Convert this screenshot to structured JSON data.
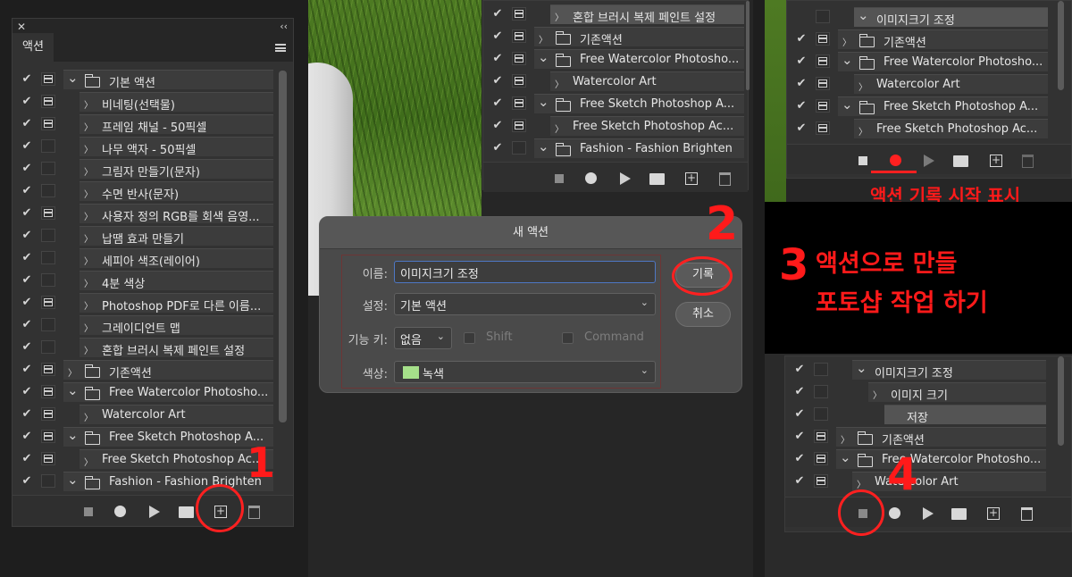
{
  "left_panel": {
    "tab_label": "액션",
    "rows": [
      {
        "checked": true,
        "toggle": true,
        "level": 0,
        "caret": "down",
        "folder": true,
        "label": "기본 액션"
      },
      {
        "checked": true,
        "toggle": true,
        "level": 1,
        "caret": "right",
        "folder": false,
        "label": "비네팅(선택물)"
      },
      {
        "checked": true,
        "toggle": true,
        "level": 1,
        "caret": "right",
        "folder": false,
        "label": "프레임 채널 - 50픽셀"
      },
      {
        "checked": true,
        "toggle": false,
        "level": 1,
        "caret": "right",
        "folder": false,
        "label": "나무 액자 - 50픽셀"
      },
      {
        "checked": true,
        "toggle": false,
        "level": 1,
        "caret": "right",
        "folder": false,
        "label": "그림자 만들기(문자)"
      },
      {
        "checked": true,
        "toggle": false,
        "level": 1,
        "caret": "right",
        "folder": false,
        "label": "수면 반사(문자)"
      },
      {
        "checked": true,
        "toggle": true,
        "level": 1,
        "caret": "right",
        "folder": false,
        "label": "사용자 정의 RGB를 회색 음영..."
      },
      {
        "checked": true,
        "toggle": false,
        "level": 1,
        "caret": "right",
        "folder": false,
        "label": "납땜 효과 만들기"
      },
      {
        "checked": true,
        "toggle": false,
        "level": 1,
        "caret": "right",
        "folder": false,
        "label": "세피아 색조(레이어)"
      },
      {
        "checked": true,
        "toggle": false,
        "level": 1,
        "caret": "right",
        "folder": false,
        "label": "4분 색상"
      },
      {
        "checked": true,
        "toggle": true,
        "level": 1,
        "caret": "right",
        "folder": false,
        "label": "Photoshop PDF로 다른 이름..."
      },
      {
        "checked": true,
        "toggle": false,
        "level": 1,
        "caret": "right",
        "folder": false,
        "label": "그레이디언트 맵"
      },
      {
        "checked": true,
        "toggle": false,
        "level": 1,
        "caret": "right",
        "folder": false,
        "label": "혼합 브러시 복제 페인트 설정"
      },
      {
        "checked": true,
        "toggle": true,
        "level": 0,
        "caret": "right",
        "folder": true,
        "label": "기존액션"
      },
      {
        "checked": true,
        "toggle": true,
        "level": 0,
        "caret": "down",
        "folder": true,
        "label": "Free Watercolor Photosho..."
      },
      {
        "checked": true,
        "toggle": true,
        "level": 1,
        "caret": "right",
        "folder": false,
        "label": "Watercolor Art"
      },
      {
        "checked": true,
        "toggle": true,
        "level": 0,
        "caret": "down",
        "folder": true,
        "label": "Free Sketch Photoshop A..."
      },
      {
        "checked": true,
        "toggle": true,
        "level": 1,
        "caret": "right",
        "folder": false,
        "label": "Free Sketch Photoshop Ac..."
      },
      {
        "checked": true,
        "toggle": false,
        "level": 0,
        "caret": "down",
        "folder": true,
        "label": "Fashion - Fashion Brighten"
      }
    ]
  },
  "mid_panel": {
    "rows": [
      {
        "checked": true,
        "toggle": true,
        "level": 1,
        "caret": "right",
        "folder": false,
        "label": "혼합 브러시 복제 페인트 설정",
        "selected": true
      },
      {
        "checked": true,
        "toggle": true,
        "level": 0,
        "caret": "right",
        "folder": true,
        "label": "기존액션"
      },
      {
        "checked": true,
        "toggle": true,
        "level": 0,
        "caret": "down",
        "folder": true,
        "label": "Free Watercolor Photosho..."
      },
      {
        "checked": true,
        "toggle": true,
        "level": 1,
        "caret": "right",
        "folder": false,
        "label": "Watercolor Art"
      },
      {
        "checked": true,
        "toggle": true,
        "level": 0,
        "caret": "down",
        "folder": true,
        "label": "Free Sketch Photoshop A..."
      },
      {
        "checked": true,
        "toggle": true,
        "level": 1,
        "caret": "right",
        "folder": false,
        "label": "Free Sketch Photoshop Ac..."
      },
      {
        "checked": true,
        "toggle": false,
        "level": 0,
        "caret": "down",
        "folder": true,
        "label": "Fashion - Fashion Brighten"
      }
    ]
  },
  "dialog": {
    "title": "새 액션",
    "name_label": "이름:",
    "name_value": "이미지크기 조정",
    "set_label": "설정:",
    "set_value": "기본 액션",
    "fkey_label": "기능 키:",
    "fkey_value": "없음",
    "shift_label": "Shift",
    "command_label": "Command",
    "color_label": "색상:",
    "color_value": "녹색",
    "color_swatch": "#a6e08a",
    "record_button": "기록",
    "cancel_button": "취소"
  },
  "right_top_panel": {
    "rows": [
      {
        "checked": false,
        "toggle": false,
        "level": 1,
        "caret": "down",
        "folder": false,
        "label": "이미지크기 조정",
        "selected": true
      },
      {
        "checked": true,
        "toggle": true,
        "level": 0,
        "caret": "right",
        "folder": true,
        "label": "기존액션"
      },
      {
        "checked": true,
        "toggle": true,
        "level": 0,
        "caret": "down",
        "folder": true,
        "label": "Free Watercolor Photosho..."
      },
      {
        "checked": true,
        "toggle": true,
        "level": 1,
        "caret": "right",
        "folder": false,
        "label": "Watercolor Art"
      },
      {
        "checked": true,
        "toggle": true,
        "level": 0,
        "caret": "down",
        "folder": true,
        "label": "Free Sketch Photoshop A..."
      },
      {
        "checked": true,
        "toggle": true,
        "level": 1,
        "caret": "right",
        "folder": false,
        "label": "Free Sketch Photoshop Ac..."
      }
    ]
  },
  "right_bottom_panel": {
    "rows": [
      {
        "checked": true,
        "toggle": false,
        "level": 1,
        "caret": "down",
        "folder": false,
        "label": "이미지크기 조정"
      },
      {
        "checked": true,
        "toggle": false,
        "level": 2,
        "caret": "right",
        "folder": false,
        "label": "이미지 크기"
      },
      {
        "checked": true,
        "toggle": false,
        "level": 3,
        "caret": "",
        "folder": false,
        "label": "저장",
        "selected": true
      },
      {
        "checked": true,
        "toggle": true,
        "level": 0,
        "caret": "right",
        "folder": true,
        "label": "기존액션"
      },
      {
        "checked": true,
        "toggle": true,
        "level": 0,
        "caret": "down",
        "folder": true,
        "label": "Free Watercolor Photosho..."
      },
      {
        "checked": true,
        "toggle": true,
        "level": 1,
        "caret": "right",
        "folder": false,
        "label": "Watercolor Art"
      }
    ]
  },
  "annotations": {
    "step1": "1",
    "step2": "2",
    "step3": "3",
    "step4": "4",
    "record_start_text": "액션 기록 시작 표시",
    "step3_line1": "액션으로 만들",
    "step3_line2": "포토샵 작업 하기",
    "accent_color": "#ff1a1a"
  }
}
